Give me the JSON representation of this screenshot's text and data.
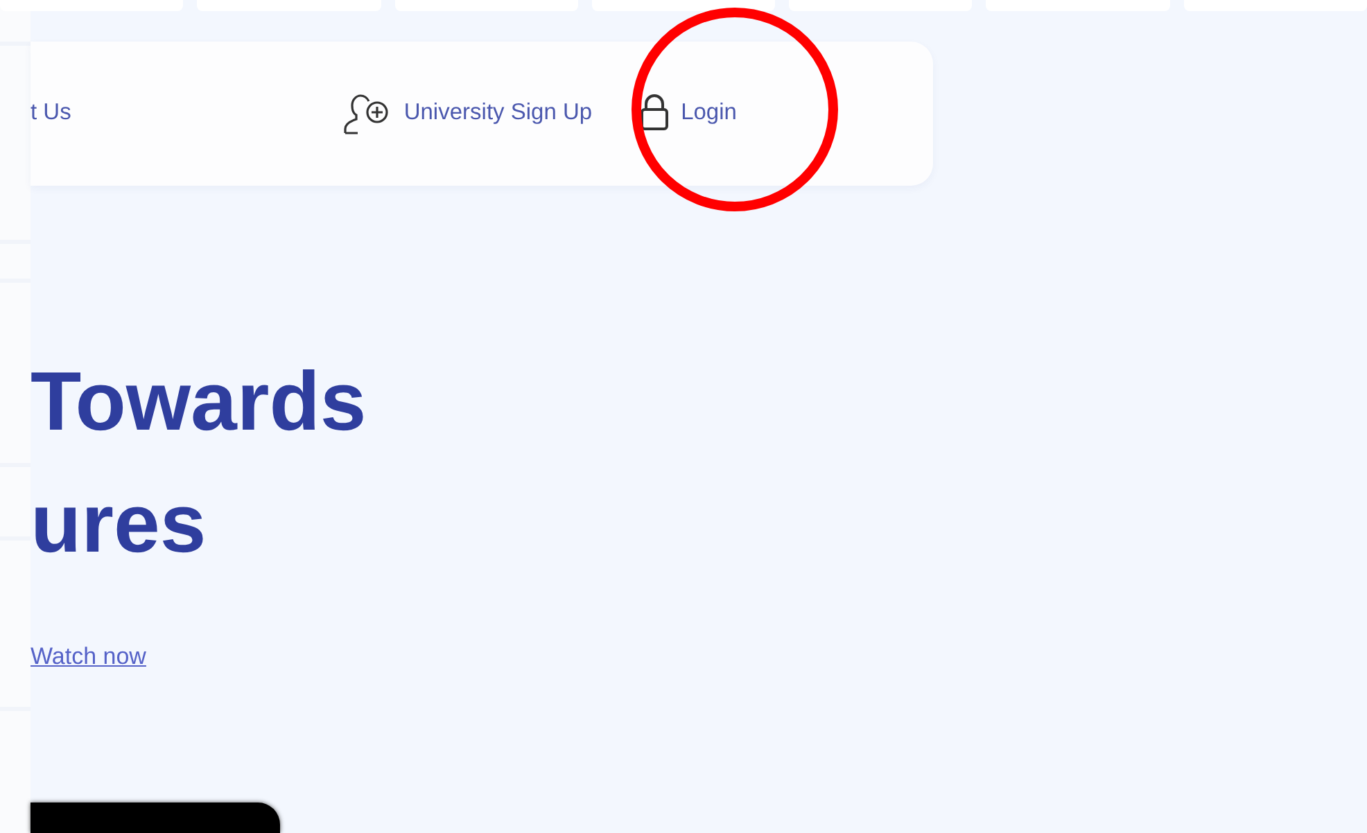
{
  "top_tiles": [
    {
      "kind": "tile"
    },
    {
      "kind": "tile"
    },
    {
      "kind": "tile"
    },
    {
      "kind": "tile"
    },
    {
      "kind": "tile"
    },
    {
      "kind": "tile"
    },
    {
      "kind": "tile"
    }
  ],
  "nav": {
    "items": [
      {
        "label": "t Us",
        "kind": "plain"
      },
      {
        "label": "University Sign Up",
        "kind": "signup"
      },
      {
        "label": "Login",
        "kind": "login"
      }
    ]
  },
  "hero": {
    "heading_lines": [
      "Towards",
      "ures"
    ],
    "link": "Watch now"
  },
  "annotation": {
    "kind": "circle"
  }
}
